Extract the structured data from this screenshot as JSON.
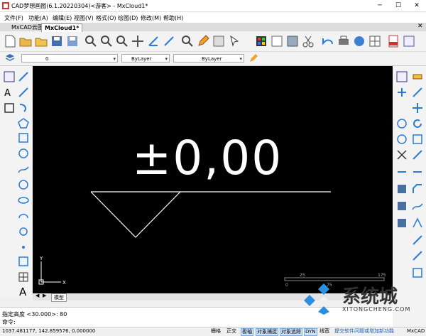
{
  "window": {
    "title": "CAD梦想画图(6.1.20220304)<游客> - MxCloud1*"
  },
  "menu": [
    {
      "label": "文件(F)"
    },
    {
      "label": "功能(A)"
    },
    {
      "label": "编辑(E)"
    },
    {
      "label": "视图(V)"
    },
    {
      "label": "格式(O)"
    },
    {
      "label": "绘图(D)"
    },
    {
      "label": "修改(M)"
    },
    {
      "label": "帮助(H)"
    }
  ],
  "doc_tabs": [
    {
      "label": "MxCAD云图"
    },
    {
      "label": "MxCloud1*"
    }
  ],
  "layer_bar": {
    "layer": "0",
    "color": "ByLayer",
    "linetype": "ByLayer"
  },
  "canvas": {
    "dim_text": "±0,00"
  },
  "bottom_tabs": {
    "model": "模型"
  },
  "scale_bar": {
    "labels": [
      "25",
      "175",
      "0",
      "75"
    ]
  },
  "command": {
    "history": "指定高度 <30.000>: 80",
    "prompt": "命令:"
  },
  "status": {
    "coords": "1037.481177, 142.859576, 0.000000",
    "buttons": [
      {
        "label": "栅格",
        "on": false
      },
      {
        "label": "正交",
        "on": false
      },
      {
        "label": "极轴",
        "on": true
      },
      {
        "label": "对象捕捉",
        "on": true
      },
      {
        "label": "对象追踪",
        "on": true
      },
      {
        "label": "DYN",
        "on": true
      },
      {
        "label": "线宽",
        "on": false
      }
    ],
    "feedback": "提交软件问题或增加新功能",
    "brand": "MxCAD"
  },
  "watermark": {
    "text": "系统城",
    "domain": "XITONGCHENG.COM"
  },
  "colors": {
    "canvas": "#000000",
    "accent": "#1e78c8"
  }
}
